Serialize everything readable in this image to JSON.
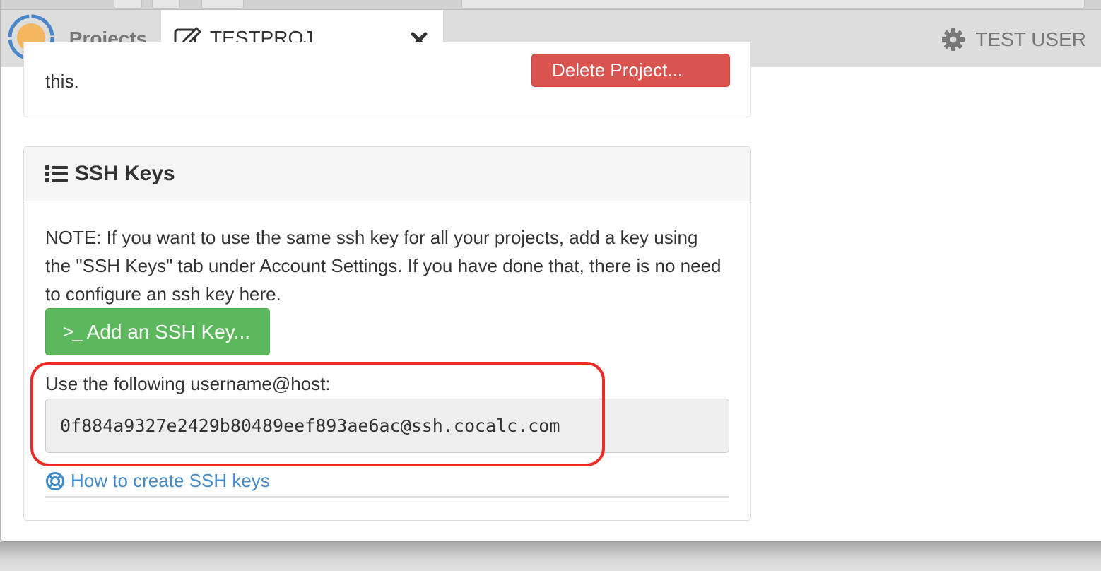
{
  "tabs": {
    "projects_label": "Projects",
    "active_label": "TESTPROJ",
    "user_label": "TEST USER"
  },
  "danger_panel": {
    "tail_text": "this.",
    "delete_label": "Delete Project..."
  },
  "ssh_panel": {
    "heading": "SSH Keys",
    "note": "NOTE: If you want to use the same ssh key for all your projects, add a key using the \"SSH Keys\" tab under Account Settings. If you have done that, there is no need to configure an ssh key here.",
    "add_key_label": "Add an SSH Key...",
    "host_label": "Use the following username@host:",
    "host_value": "0f884a9327e2429b80489eef893ae6ac@ssh.cocalc.com",
    "help_link": "How to create SSH keys"
  },
  "colors": {
    "accent_link": "#428bca",
    "success": "#5cb85c",
    "danger": "#d9534f",
    "highlight": "#ee2a24",
    "logo": "#f4b65f"
  },
  "icons": [
    "cocalc-logo-icon",
    "edit-icon",
    "close-icon",
    "gear-icon",
    "list-icon",
    "terminal-icon",
    "life-ring-icon",
    "trash-icon"
  ]
}
